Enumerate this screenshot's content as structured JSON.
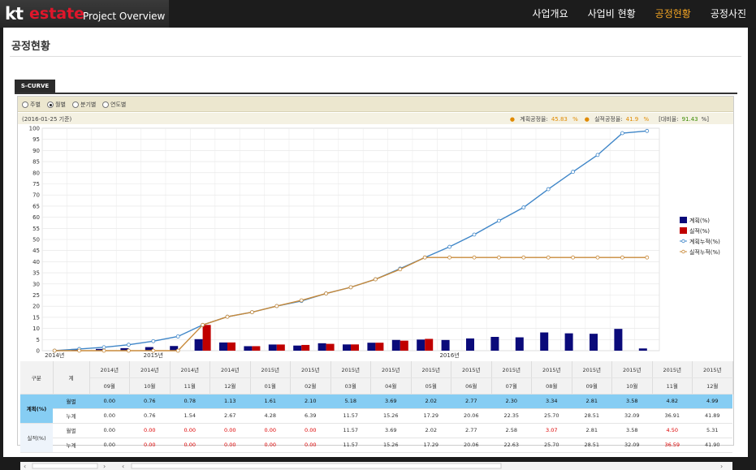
{
  "header": {
    "logo_kt": "kt",
    "logo_estate": "estate",
    "logo_sub": "Project Overview",
    "nav": [
      "사업개요",
      "사업비 현황",
      "공정현황",
      "공정사진"
    ],
    "active_nav": 2
  },
  "page": {
    "title": "공정현황",
    "tab": "S-CURVE",
    "periods": [
      "주별",
      "월별",
      "분기별",
      "연도별"
    ],
    "selected_period": 1,
    "basis": "(2016-01-25 기준)",
    "plan_rate_label": "계획공정율:",
    "plan_rate_value": "45.83",
    "actual_rate_label": "실적공정율:",
    "actual_rate_value": "41.9",
    "pct": "%",
    "ratio_label": "[대비율:",
    "ratio_value": "91.43",
    "ratio_suffix": "%]"
  },
  "chart_data": {
    "type": "bar",
    "x": [
      "2014-09",
      "2014-10",
      "2014-11",
      "2014-12",
      "2015-01",
      "2015-02",
      "2015-03",
      "2015-04",
      "2015-05",
      "2015-06",
      "2015-07",
      "2015-08",
      "2015-09",
      "2015-10",
      "2015-11",
      "2015-12",
      "2016-01",
      "2016-02",
      "2016-03",
      "2016-04",
      "2016-05",
      "2016-06",
      "2016-07",
      "2016-08",
      "2016-09"
    ],
    "month_labels": [
      "09월",
      "10월",
      "11월",
      "12월",
      "01월",
      "02월",
      "03월",
      "04월",
      "05월",
      "06월",
      "07월",
      "08월",
      "09월",
      "10월",
      "11월",
      "12월",
      "01월",
      "02월",
      "03월",
      "04월",
      "05월",
      "06월",
      "07월",
      "08월",
      "09월"
    ],
    "year_labels": [
      {
        "index": 0,
        "label": "2014년"
      },
      {
        "index": 4,
        "label": "2015년"
      },
      {
        "index": 16,
        "label": "2016년"
      }
    ],
    "yticks": [
      0,
      5,
      10,
      15,
      20,
      25,
      30,
      35,
      40,
      45,
      50,
      55,
      60,
      65,
      70,
      75,
      80,
      85,
      90,
      95,
      100
    ],
    "ylim": [
      0,
      100
    ],
    "grid": true,
    "legend_position": "right",
    "series": [
      {
        "name": "계획(%)",
        "kind": "bar",
        "color": "#0a0a7a",
        "values": [
          0.0,
          0.76,
          0.78,
          1.13,
          1.61,
          2.1,
          5.18,
          3.69,
          2.02,
          2.77,
          2.3,
          3.34,
          2.81,
          3.58,
          4.82,
          4.99,
          4.8,
          5.5,
          6.2,
          6.0,
          8.2,
          7.8,
          7.6,
          9.8,
          1.0
        ]
      },
      {
        "name": "실적(%)",
        "kind": "bar",
        "color": "#c00000",
        "values": [
          0.0,
          0.0,
          0.0,
          0.0,
          0.0,
          0.0,
          11.57,
          3.69,
          2.02,
          2.77,
          2.58,
          3.07,
          2.81,
          3.58,
          4.5,
          5.31,
          0,
          0,
          0,
          0,
          0,
          0,
          0,
          0,
          0
        ]
      },
      {
        "name": "계획누적(%)",
        "kind": "line",
        "color": "#3f86c8",
        "values": [
          0.0,
          0.76,
          1.54,
          2.67,
          4.28,
          6.39,
          11.57,
          15.26,
          17.29,
          20.06,
          22.35,
          25.7,
          28.51,
          32.09,
          36.91,
          41.89,
          46.7,
          52.2,
          58.4,
          64.4,
          72.6,
          80.4,
          88.0,
          97.8,
          98.8
        ]
      },
      {
        "name": "실적누적(%)",
        "kind": "line",
        "color": "#c88a3a",
        "values": [
          0.0,
          0.0,
          0.0,
          0.0,
          0.0,
          0.0,
          11.57,
          15.26,
          17.29,
          20.06,
          22.63,
          25.7,
          28.51,
          32.09,
          36.59,
          41.9,
          41.9,
          41.9,
          41.9,
          41.9,
          41.9,
          41.9,
          41.9,
          41.9,
          41.9
        ]
      }
    ]
  },
  "table": {
    "col_gubun": "구분",
    "col_total": "계",
    "years": [
      "2014년",
      "2014년",
      "2014년",
      "2014년",
      "2015년",
      "2015년",
      "2015년",
      "2015년",
      "2015년",
      "2015년",
      "2015년",
      "2015년",
      "2015년",
      "2015년",
      "2015년",
      "2015년"
    ],
    "months": [
      "09월",
      "10월",
      "11월",
      "12월",
      "01월",
      "02월",
      "03월",
      "04월",
      "05월",
      "06월",
      "07월",
      "08월",
      "09월",
      "10월",
      "11월",
      "12월"
    ],
    "plan_label": "계획(%)",
    "actual_label": "실적(%)",
    "monthly": "월별",
    "cumulative": "누계",
    "plan_monthly": [
      "0.00",
      "0.76",
      "0.78",
      "1.13",
      "1.61",
      "2.10",
      "5.18",
      "3.69",
      "2.02",
      "2.77",
      "2.30",
      "3.34",
      "2.81",
      "3.58",
      "4.82",
      "4.99"
    ],
    "plan_cum": [
      "0.00",
      "0.76",
      "1.54",
      "2.67",
      "4.28",
      "6.39",
      "11.57",
      "15.26",
      "17.29",
      "20.06",
      "22.35",
      "25.70",
      "28.51",
      "32.09",
      "36.91",
      "41.89"
    ],
    "actual_monthly": [
      "0.00",
      "0.00",
      "0.00",
      "0.00",
      "0.00",
      "0.00",
      "11.57",
      "3.69",
      "2.02",
      "2.77",
      "2.58",
      "3.07",
      "2.81",
      "3.58",
      "4.50",
      "5.31"
    ],
    "actual_cum": [
      "0.00",
      "0.00",
      "0.00",
      "0.00",
      "0.00",
      "0.00",
      "11.57",
      "15.26",
      "17.29",
      "20.06",
      "22.63",
      "25.70",
      "28.51",
      "32.09",
      "36.59",
      "41.90"
    ],
    "actual_monthly_red": [
      1,
      2,
      3,
      4,
      5,
      11,
      14
    ],
    "actual_cum_red": [
      1,
      2,
      3,
      4,
      5,
      14
    ]
  }
}
